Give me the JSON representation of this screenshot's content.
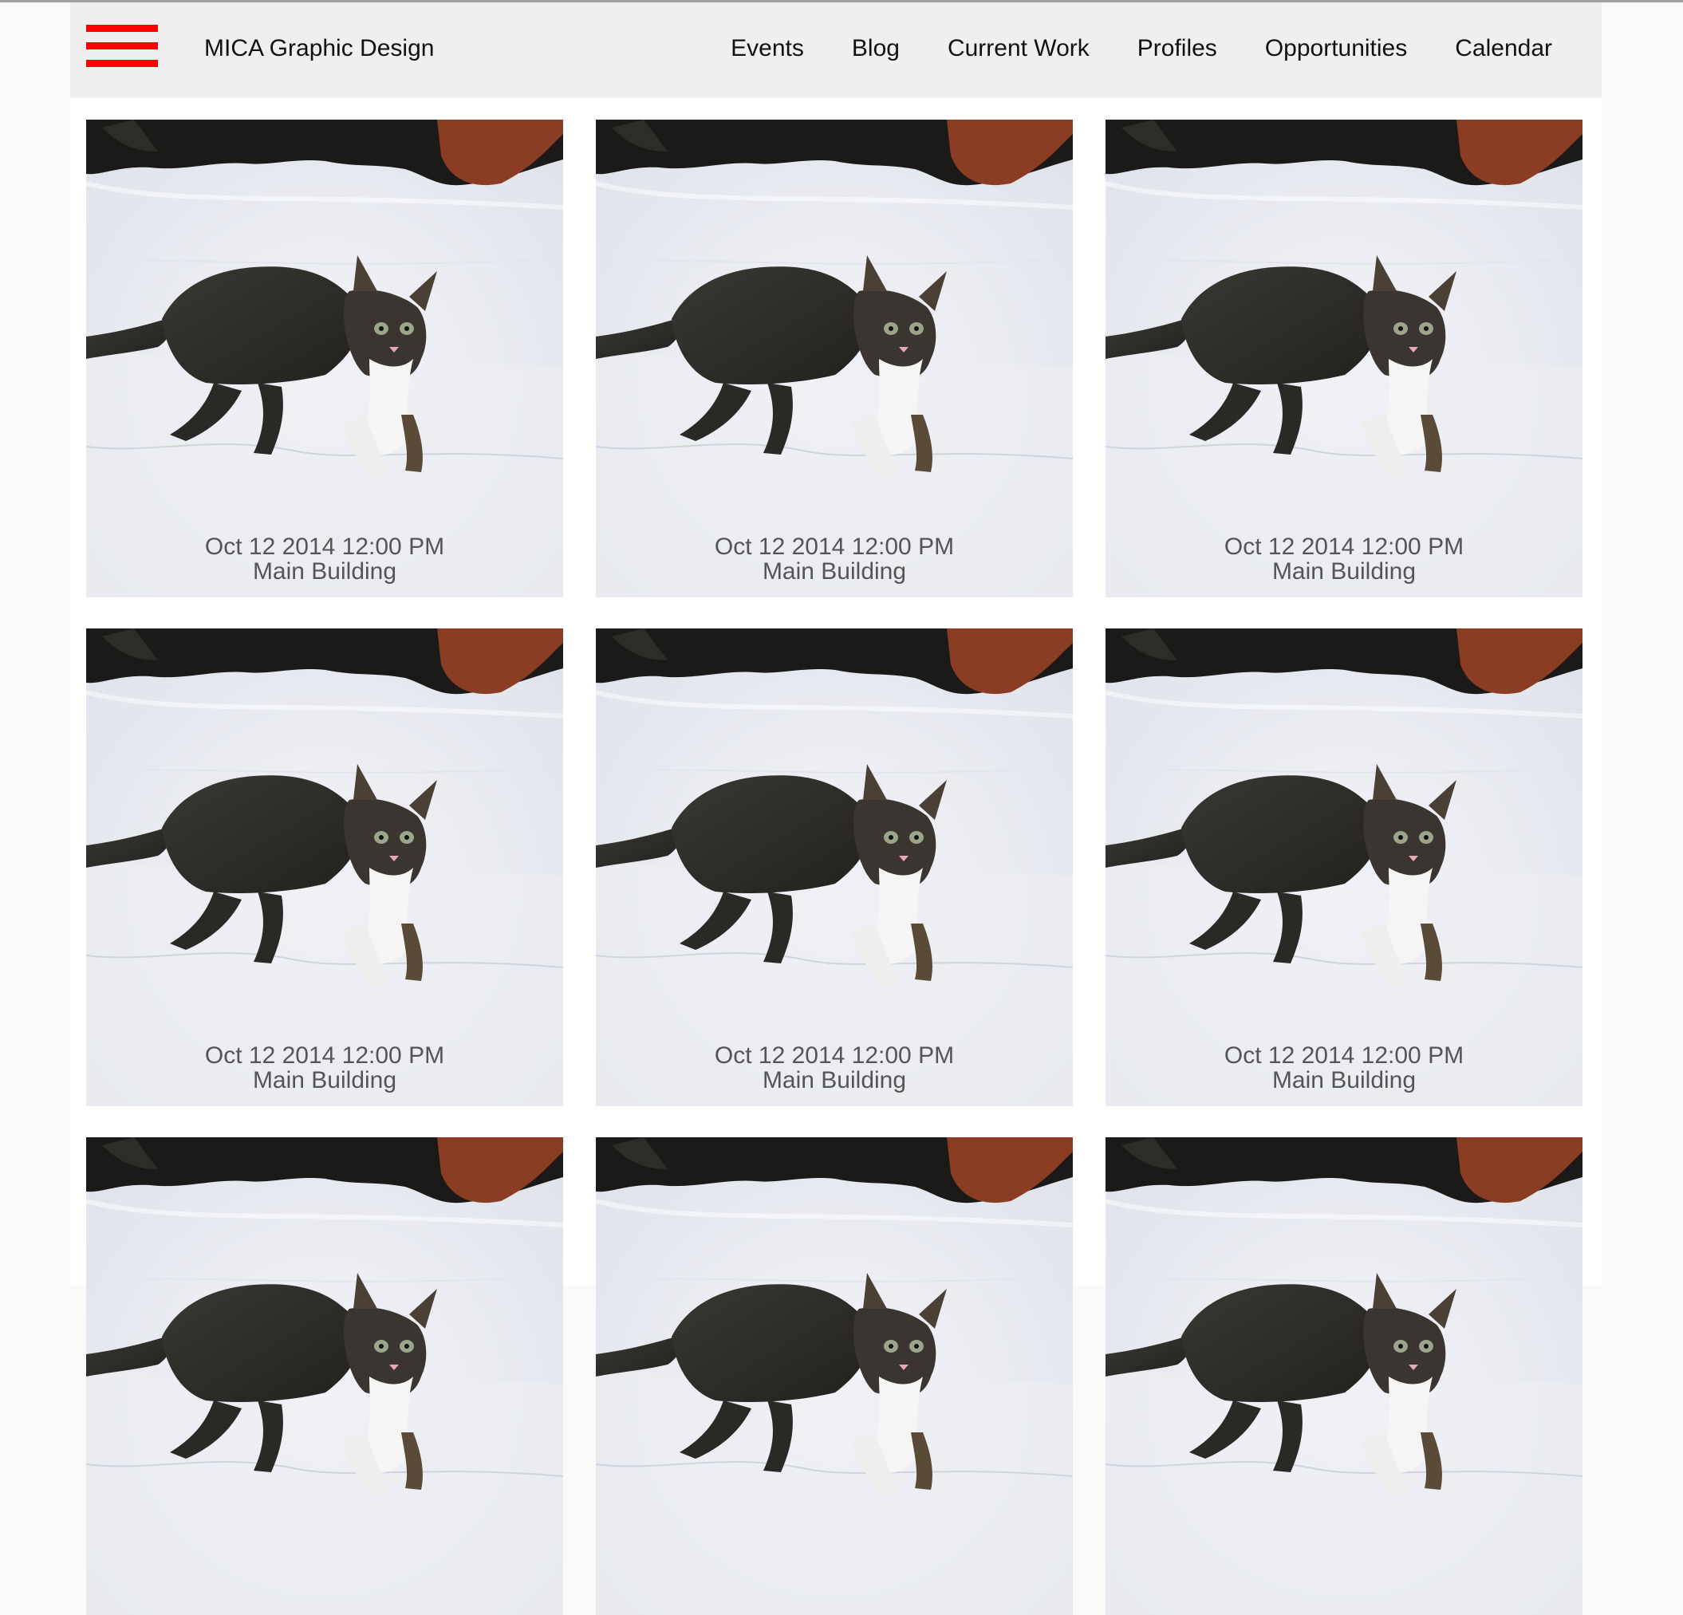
{
  "header": {
    "site_title": "MICA Graphic Design",
    "menu_icon": "hamburger-menu-icon",
    "accent_color": "#ff0000",
    "nav": [
      {
        "label": "Events"
      },
      {
        "label": "Blog"
      },
      {
        "label": "Current Work"
      },
      {
        "label": "Profiles"
      },
      {
        "label": "Opportunities"
      },
      {
        "label": "Calendar"
      }
    ]
  },
  "events": [
    {
      "datetime": "Oct 12 2014 12:00 PM",
      "location": "Main Building",
      "image": "kitten-in-snow"
    },
    {
      "datetime": "Oct 12 2014 12:00 PM",
      "location": "Main Building",
      "image": "kitten-in-snow"
    },
    {
      "datetime": "Oct 12 2014 12:00 PM",
      "location": "Main Building",
      "image": "kitten-in-snow"
    },
    {
      "datetime": "Oct 12 2014 12:00 PM",
      "location": "Main Building",
      "image": "kitten-in-snow"
    },
    {
      "datetime": "Oct 12 2014 12:00 PM",
      "location": "Main Building",
      "image": "kitten-in-snow"
    },
    {
      "datetime": "Oct 12 2014 12:00 PM",
      "location": "Main Building",
      "image": "kitten-in-snow"
    },
    {
      "datetime": "",
      "location": "",
      "image": "kitten-in-snow"
    },
    {
      "datetime": "",
      "location": "",
      "image": "kitten-in-snow"
    },
    {
      "datetime": "",
      "location": "",
      "image": "kitten-in-snow"
    }
  ]
}
